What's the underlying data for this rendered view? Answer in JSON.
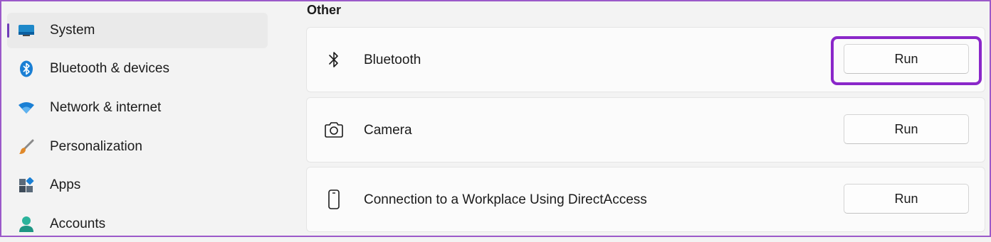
{
  "sidebar": {
    "items": [
      {
        "label": "System",
        "icon": "system-icon",
        "selected": true
      },
      {
        "label": "Bluetooth & devices",
        "icon": "bluetooth-devices-icon",
        "selected": false
      },
      {
        "label": "Network & internet",
        "icon": "wifi-icon",
        "selected": false
      },
      {
        "label": "Personalization",
        "icon": "brush-icon",
        "selected": false
      },
      {
        "label": "Apps",
        "icon": "apps-icon",
        "selected": false
      },
      {
        "label": "Accounts",
        "icon": "person-icon",
        "selected": false
      }
    ]
  },
  "main": {
    "section_title": "Other",
    "troubleshooters": [
      {
        "label": "Bluetooth",
        "icon": "bluetooth-icon",
        "button": "Run",
        "highlighted": true
      },
      {
        "label": "Camera",
        "icon": "camera-icon",
        "button": "Run",
        "highlighted": false
      },
      {
        "label": "Connection to a Workplace Using DirectAccess",
        "icon": "phone-icon",
        "button": "Run",
        "highlighted": false
      }
    ]
  },
  "colors": {
    "accent": "#6e3cb8",
    "highlight_border": "#8a27c9",
    "background": "#f3f3f3",
    "card": "#fbfbfb"
  }
}
